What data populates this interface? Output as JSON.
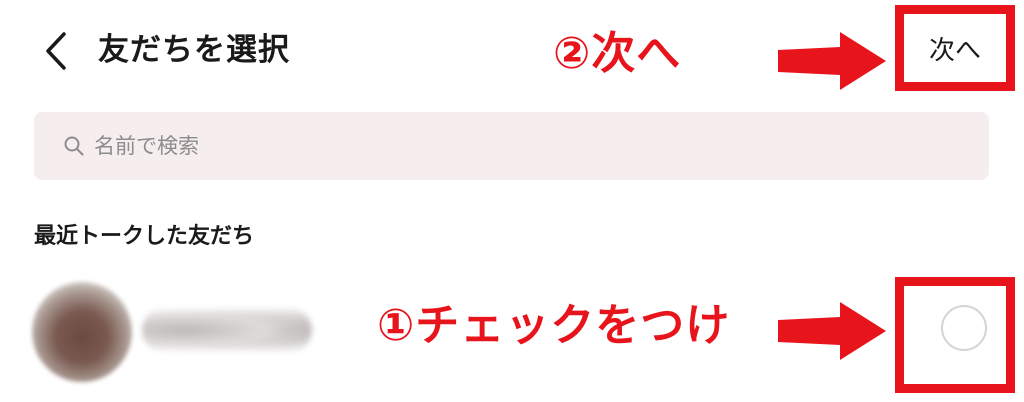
{
  "header": {
    "back_icon": "chevron-left-icon",
    "title": "友だちを選択",
    "next_label": "次へ"
  },
  "search": {
    "placeholder": "名前で検索",
    "icon": "search-icon"
  },
  "section": {
    "title": "最近トークした友だち"
  },
  "friends": [
    {
      "name_visible": false,
      "avatar_visible": false,
      "checked": false
    }
  ],
  "annotations": {
    "next_note": "②次へ",
    "check_note": "①チェックをつけ",
    "color": "#e8141c"
  },
  "colors": {
    "search_bg": "#f6edee",
    "annotation_red": "#e8141c",
    "text_primary": "#1a1a1a",
    "placeholder": "#8c8c8c"
  }
}
